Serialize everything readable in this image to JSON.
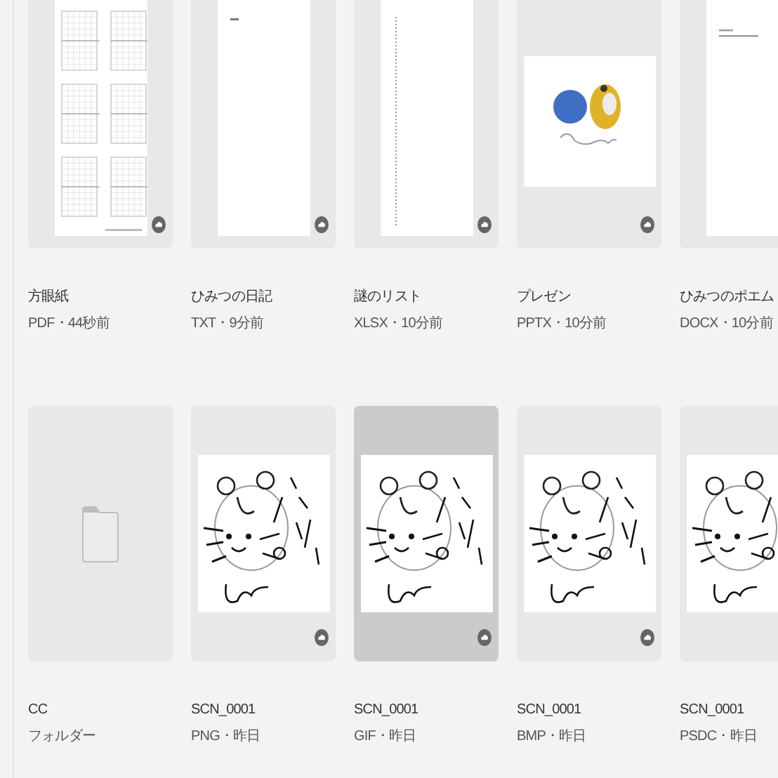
{
  "files": [
    {
      "name": "方眼紙",
      "meta": "PDF・44秒前",
      "kind": "graph",
      "synced": true,
      "selected": false
    },
    {
      "name": "ひみつの日記",
      "meta": "TXT・9分前",
      "kind": "note",
      "synced": true,
      "selected": false
    },
    {
      "name": "謎のリスト",
      "meta": "XLSX・10分前",
      "kind": "list",
      "synced": true,
      "selected": false
    },
    {
      "name": "プレゼン",
      "meta": "PPTX・10分前",
      "kind": "slides",
      "synced": true,
      "selected": false
    },
    {
      "name": "ひみつのポエム",
      "meta": "DOCX・10分前",
      "kind": "text",
      "selected": false
    },
    {
      "name": "CC",
      "meta": "フォルダー",
      "kind": "folder",
      "selected": false
    },
    {
      "name": "SCN_0001",
      "meta": "PNG・昨日",
      "synced": true,
      "selected": false
    },
    {
      "name": "SCN_0001",
      "meta": "GIF・昨日",
      "synced": true,
      "selected": true
    },
    {
      "name": "SCN_0001",
      "meta": "BMP・昨日",
      "synced": true,
      "selected": false
    },
    {
      "name": "SCN_0001",
      "meta": "PSDC・昨日",
      "selected": false
    }
  ]
}
